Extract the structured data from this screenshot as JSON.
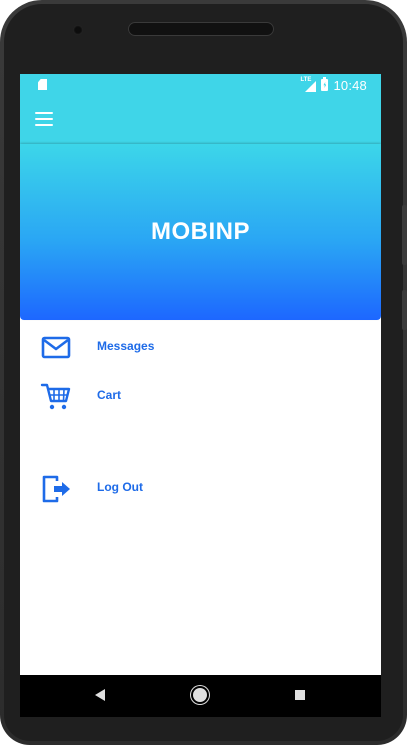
{
  "status_bar": {
    "time": "10:48",
    "network_label": "LTE",
    "icons": [
      "sd-card-icon",
      "lte-signal-icon",
      "battery-charging-icon"
    ]
  },
  "app_bar": {
    "menu_icon": "hamburger-icon"
  },
  "drawer_header": {
    "title": "MOBINP",
    "gradient": [
      "#3cd6e9",
      "#1d67ff"
    ]
  },
  "menu": {
    "items": [
      {
        "label": "Messages",
        "icon": "mail-icon"
      },
      {
        "label": "Cart",
        "icon": "cart-icon"
      },
      {
        "label": "Log Out",
        "icon": "logout-icon"
      }
    ]
  },
  "nav_bar": {
    "buttons": [
      "back-icon",
      "home-icon",
      "recents-icon"
    ]
  },
  "colors": {
    "accent": "#3fd5e8",
    "menu_text": "#1e6be8",
    "icon": "#1e6be8"
  }
}
